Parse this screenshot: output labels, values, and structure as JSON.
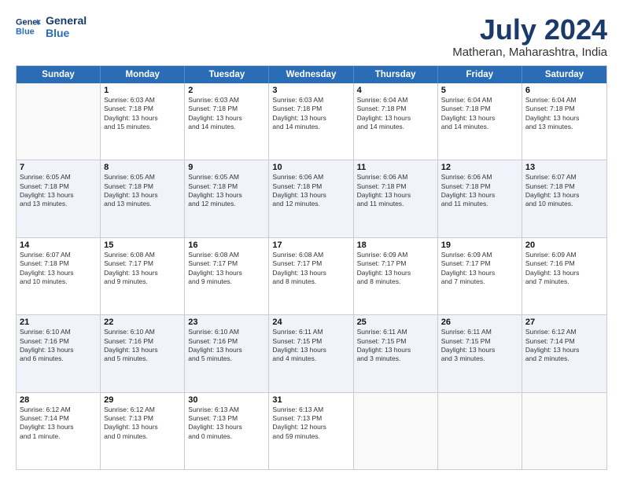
{
  "header": {
    "logo_line1": "General",
    "logo_line2": "Blue",
    "month": "July 2024",
    "location": "Matheran, Maharashtra, India"
  },
  "weekdays": [
    "Sunday",
    "Monday",
    "Tuesday",
    "Wednesday",
    "Thursday",
    "Friday",
    "Saturday"
  ],
  "rows": [
    [
      {
        "day": "",
        "lines": []
      },
      {
        "day": "1",
        "lines": [
          "Sunrise: 6:03 AM",
          "Sunset: 7:18 PM",
          "Daylight: 13 hours",
          "and 15 minutes."
        ]
      },
      {
        "day": "2",
        "lines": [
          "Sunrise: 6:03 AM",
          "Sunset: 7:18 PM",
          "Daylight: 13 hours",
          "and 14 minutes."
        ]
      },
      {
        "day": "3",
        "lines": [
          "Sunrise: 6:03 AM",
          "Sunset: 7:18 PM",
          "Daylight: 13 hours",
          "and 14 minutes."
        ]
      },
      {
        "day": "4",
        "lines": [
          "Sunrise: 6:04 AM",
          "Sunset: 7:18 PM",
          "Daylight: 13 hours",
          "and 14 minutes."
        ]
      },
      {
        "day": "5",
        "lines": [
          "Sunrise: 6:04 AM",
          "Sunset: 7:18 PM",
          "Daylight: 13 hours",
          "and 14 minutes."
        ]
      },
      {
        "day": "6",
        "lines": [
          "Sunrise: 6:04 AM",
          "Sunset: 7:18 PM",
          "Daylight: 13 hours",
          "and 13 minutes."
        ]
      }
    ],
    [
      {
        "day": "7",
        "lines": [
          "Sunrise: 6:05 AM",
          "Sunset: 7:18 PM",
          "Daylight: 13 hours",
          "and 13 minutes."
        ]
      },
      {
        "day": "8",
        "lines": [
          "Sunrise: 6:05 AM",
          "Sunset: 7:18 PM",
          "Daylight: 13 hours",
          "and 13 minutes."
        ]
      },
      {
        "day": "9",
        "lines": [
          "Sunrise: 6:05 AM",
          "Sunset: 7:18 PM",
          "Daylight: 13 hours",
          "and 12 minutes."
        ]
      },
      {
        "day": "10",
        "lines": [
          "Sunrise: 6:06 AM",
          "Sunset: 7:18 PM",
          "Daylight: 13 hours",
          "and 12 minutes."
        ]
      },
      {
        "day": "11",
        "lines": [
          "Sunrise: 6:06 AM",
          "Sunset: 7:18 PM",
          "Daylight: 13 hours",
          "and 11 minutes."
        ]
      },
      {
        "day": "12",
        "lines": [
          "Sunrise: 6:06 AM",
          "Sunset: 7:18 PM",
          "Daylight: 13 hours",
          "and 11 minutes."
        ]
      },
      {
        "day": "13",
        "lines": [
          "Sunrise: 6:07 AM",
          "Sunset: 7:18 PM",
          "Daylight: 13 hours",
          "and 10 minutes."
        ]
      }
    ],
    [
      {
        "day": "14",
        "lines": [
          "Sunrise: 6:07 AM",
          "Sunset: 7:18 PM",
          "Daylight: 13 hours",
          "and 10 minutes."
        ]
      },
      {
        "day": "15",
        "lines": [
          "Sunrise: 6:08 AM",
          "Sunset: 7:17 PM",
          "Daylight: 13 hours",
          "and 9 minutes."
        ]
      },
      {
        "day": "16",
        "lines": [
          "Sunrise: 6:08 AM",
          "Sunset: 7:17 PM",
          "Daylight: 13 hours",
          "and 9 minutes."
        ]
      },
      {
        "day": "17",
        "lines": [
          "Sunrise: 6:08 AM",
          "Sunset: 7:17 PM",
          "Daylight: 13 hours",
          "and 8 minutes."
        ]
      },
      {
        "day": "18",
        "lines": [
          "Sunrise: 6:09 AM",
          "Sunset: 7:17 PM",
          "Daylight: 13 hours",
          "and 8 minutes."
        ]
      },
      {
        "day": "19",
        "lines": [
          "Sunrise: 6:09 AM",
          "Sunset: 7:17 PM",
          "Daylight: 13 hours",
          "and 7 minutes."
        ]
      },
      {
        "day": "20",
        "lines": [
          "Sunrise: 6:09 AM",
          "Sunset: 7:16 PM",
          "Daylight: 13 hours",
          "and 7 minutes."
        ]
      }
    ],
    [
      {
        "day": "21",
        "lines": [
          "Sunrise: 6:10 AM",
          "Sunset: 7:16 PM",
          "Daylight: 13 hours",
          "and 6 minutes."
        ]
      },
      {
        "day": "22",
        "lines": [
          "Sunrise: 6:10 AM",
          "Sunset: 7:16 PM",
          "Daylight: 13 hours",
          "and 5 minutes."
        ]
      },
      {
        "day": "23",
        "lines": [
          "Sunrise: 6:10 AM",
          "Sunset: 7:16 PM",
          "Daylight: 13 hours",
          "and 5 minutes."
        ]
      },
      {
        "day": "24",
        "lines": [
          "Sunrise: 6:11 AM",
          "Sunset: 7:15 PM",
          "Daylight: 13 hours",
          "and 4 minutes."
        ]
      },
      {
        "day": "25",
        "lines": [
          "Sunrise: 6:11 AM",
          "Sunset: 7:15 PM",
          "Daylight: 13 hours",
          "and 3 minutes."
        ]
      },
      {
        "day": "26",
        "lines": [
          "Sunrise: 6:11 AM",
          "Sunset: 7:15 PM",
          "Daylight: 13 hours",
          "and 3 minutes."
        ]
      },
      {
        "day": "27",
        "lines": [
          "Sunrise: 6:12 AM",
          "Sunset: 7:14 PM",
          "Daylight: 13 hours",
          "and 2 minutes."
        ]
      }
    ],
    [
      {
        "day": "28",
        "lines": [
          "Sunrise: 6:12 AM",
          "Sunset: 7:14 PM",
          "Daylight: 13 hours",
          "and 1 minute."
        ]
      },
      {
        "day": "29",
        "lines": [
          "Sunrise: 6:12 AM",
          "Sunset: 7:13 PM",
          "Daylight: 13 hours",
          "and 0 minutes."
        ]
      },
      {
        "day": "30",
        "lines": [
          "Sunrise: 6:13 AM",
          "Sunset: 7:13 PM",
          "Daylight: 13 hours",
          "and 0 minutes."
        ]
      },
      {
        "day": "31",
        "lines": [
          "Sunrise: 6:13 AM",
          "Sunset: 7:13 PM",
          "Daylight: 12 hours",
          "and 59 minutes."
        ]
      },
      {
        "day": "",
        "lines": []
      },
      {
        "day": "",
        "lines": []
      },
      {
        "day": "",
        "lines": []
      }
    ]
  ]
}
